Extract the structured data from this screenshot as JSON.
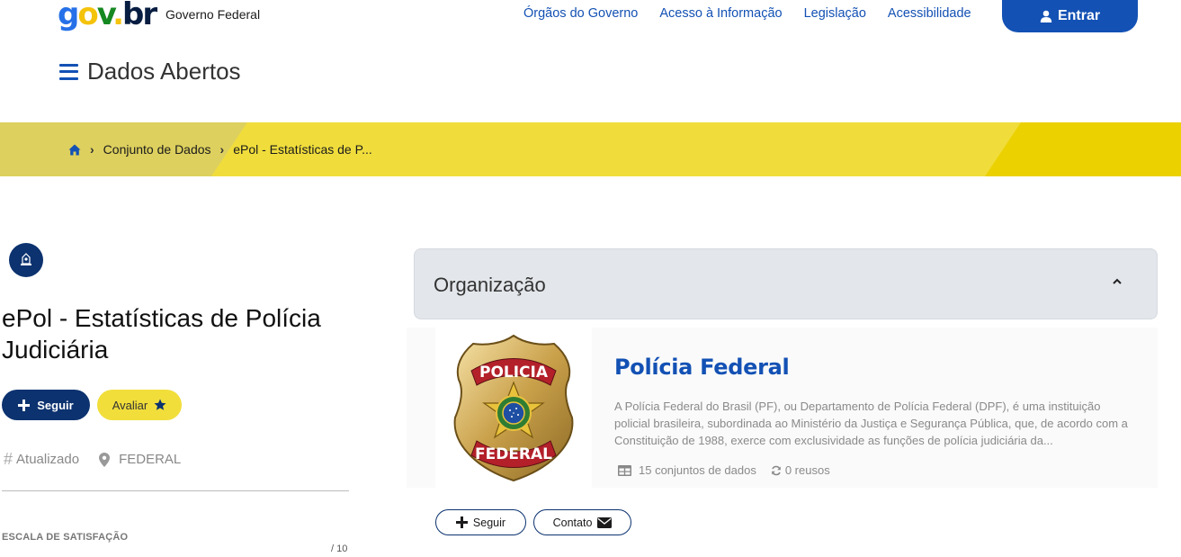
{
  "header": {
    "logo_g": "g",
    "logo_o": "o",
    "logo_v": "v",
    "logo_dot": ".",
    "logo_br": "br",
    "gov_name": "Governo Federal",
    "nav": [
      "Órgãos do Governo",
      "Acesso à Informação",
      "Legislação",
      "Acessibilidade"
    ],
    "login_label": "Entrar",
    "site_title": "Dados Abertos"
  },
  "breadcrumb": {
    "items": [
      "Conjunto de Dados",
      "ePol - Estatísticas de P..."
    ]
  },
  "dataset": {
    "title": "ePol - Estatísticas de Polícia Judiciária",
    "follow_label": "Seguir",
    "rate_label": "Avaliar",
    "status": "Atualizado",
    "scope": "FEDERAL",
    "satisfaction_label": "ESCALA DE SATISFAÇÃO",
    "score_suffix": "/ 10"
  },
  "organization": {
    "section_label": "Organização",
    "name": "Polícia Federal",
    "description": "A Polícia Federal do Brasil (PF), ou Departamento de Polícia Federal (DPF), é uma instituição policial brasileira, subordinada ao Ministério da Justiça e Segurança Pública, que, de acordo com a Constituição de 1988, exerce com exclusividade as funções de polícia judiciária da...",
    "datasets_count": "15 conjuntos de dados",
    "reuses_count": "0 reusos",
    "badge_top": "POLICIA",
    "badge_bottom": "FEDERAL",
    "follow_label": "Seguir",
    "contact_label": "Contato"
  },
  "colors": {
    "primary": "#1351b4",
    "dark_blue": "#0c326f",
    "yellow": "#f1de3b"
  },
  "icons": [
    "user-icon",
    "menu-icon",
    "home-icon",
    "chevron-right-icon",
    "organization-icon",
    "plus-icon",
    "star-icon",
    "hash-icon",
    "map-pin-icon",
    "chevron-up-icon",
    "table-icon",
    "refresh-icon",
    "envelope-icon"
  ]
}
